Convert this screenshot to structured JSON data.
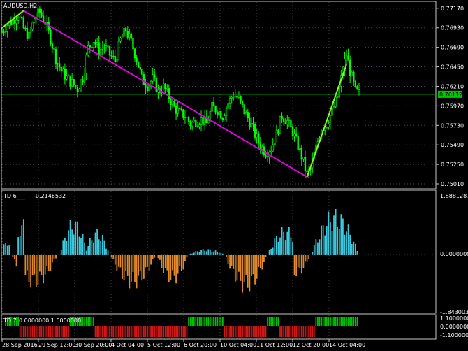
{
  "symbol_label": "AUDUSD,H2",
  "colors": {
    "background": "#000000",
    "frame": "#c8c8c8",
    "grid": "#3c4650",
    "candle": "#00ff00",
    "trend_line": "#e000e0",
    "cyan": "#3cc8dc",
    "orange": "#e08a2c",
    "bull_bar": "#00c000",
    "bear_bar": "#d01818",
    "current_price_bg": "#00c800"
  },
  "price_axis": {
    "labels": [
      "0.77170",
      "0.76930",
      "0.76690",
      "0.76450",
      "0.76210",
      "0.75970",
      "0.75730",
      "0.75490",
      "0.75250",
      "0.75010"
    ],
    "current_price": "0.76112"
  },
  "time_axis": {
    "labels": [
      "28 Sep 2016",
      "29 Sep 12:00",
      "30 Sep 20:00",
      "4 Oct 04:00",
      "5 Oct 12:00",
      "6 Oct 20:00",
      "10 Oct 04:00",
      "11 Oct 12:00",
      "12 Oct 20:00",
      "14 Oct 04:00"
    ]
  },
  "indicator1": {
    "title": "TD 6___",
    "value": "-0.2146532",
    "axis_labels": [
      "1.8881287",
      "0.0000000",
      "-1.8430038"
    ]
  },
  "indicator2": {
    "title": "TD 7",
    "values": "0.0000000 1.0000000",
    "axis_labels": [
      "1.1000000",
      "0.0000000",
      "-1.1000000"
    ]
  },
  "chart_data": {
    "type": "candlestick",
    "symbol": "AUDUSD",
    "timeframe": "H2",
    "ylim": [
      0.7495,
      0.7722
    ],
    "current_price": 0.76112,
    "close_path": [
      [
        0,
        0.7688
      ],
      [
        3,
        0.7697
      ],
      [
        6,
        0.7702
      ],
      [
        9,
        0.771
      ],
      [
        12,
        0.7692
      ],
      [
        15,
        0.7682
      ],
      [
        18,
        0.7705
      ],
      [
        21,
        0.7712
      ],
      [
        24,
        0.77
      ],
      [
        27,
        0.768
      ],
      [
        30,
        0.7655
      ],
      [
        33,
        0.764
      ],
      [
        36,
        0.7632
      ],
      [
        39,
        0.7625
      ],
      [
        42,
        0.7618
      ],
      [
        45,
        0.7632
      ],
      [
        48,
        0.7668
      ],
      [
        51,
        0.7678
      ],
      [
        54,
        0.7665
      ],
      [
        57,
        0.767
      ],
      [
        60,
        0.766
      ],
      [
        63,
        0.7652
      ],
      [
        66,
        0.7678
      ],
      [
        69,
        0.769
      ],
      [
        72,
        0.7675
      ],
      [
        75,
        0.7655
      ],
      [
        78,
        0.763
      ],
      [
        81,
        0.7622
      ],
      [
        84,
        0.763
      ],
      [
        87,
        0.7615
      ],
      [
        90,
        0.762
      ],
      [
        93,
        0.7608
      ],
      [
        96,
        0.7595
      ],
      [
        99,
        0.7588
      ],
      [
        102,
        0.7585
      ],
      [
        105,
        0.7575
      ],
      [
        108,
        0.7578
      ],
      [
        111,
        0.758
      ],
      [
        114,
        0.7575
      ],
      [
        117,
        0.7595
      ],
      [
        120,
        0.7592
      ],
      [
        123,
        0.7585
      ],
      [
        126,
        0.76
      ],
      [
        129,
        0.7612
      ],
      [
        132,
        0.7605
      ],
      [
        135,
        0.759
      ],
      [
        138,
        0.7578
      ],
      [
        141,
        0.7562
      ],
      [
        144,
        0.7548
      ],
      [
        147,
        0.754
      ],
      [
        150,
        0.7545
      ],
      [
        153,
        0.7562
      ],
      [
        156,
        0.7585
      ],
      [
        159,
        0.7578
      ],
      [
        162,
        0.7565
      ],
      [
        165,
        0.7548
      ],
      [
        168,
        0.7528
      ],
      [
        170,
        0.7512
      ],
      [
        172,
        0.752
      ],
      [
        175,
        0.7545
      ],
      [
        178,
        0.757
      ],
      [
        181,
        0.7575
      ],
      [
        184,
        0.759
      ],
      [
        187,
        0.7608
      ],
      [
        190,
        0.7642
      ],
      [
        192,
        0.766
      ],
      [
        194,
        0.764
      ],
      [
        197,
        0.7615
      ],
      [
        199,
        0.7612
      ]
    ],
    "trend_lines": [
      {
        "color": "magenta",
        "points": [
          [
            12,
            0.7714
          ],
          [
            170,
            0.75095
          ]
        ]
      },
      {
        "color": "green",
        "points": [
          [
            0,
            0.7693
          ],
          [
            12,
            0.7714
          ]
        ]
      },
      {
        "color": "green",
        "points": [
          [
            170,
            0.75095
          ],
          [
            192,
            0.7648
          ]
        ]
      }
    ],
    "indicators": [
      {
        "name": "TD 6___",
        "value": -0.2146532,
        "ylim": [
          -1.8430038,
          1.8881287
        ],
        "type": "histogram",
        "segments": [
          {
            "from": 0,
            "to": 5,
            "sign": 1,
            "peak": 0.6
          },
          {
            "from": 5,
            "to": 31,
            "sign": -1,
            "peak": 1.2
          },
          {
            "from": 8,
            "to": 14,
            "sign": 1,
            "peak": 1.4
          },
          {
            "from": 32,
            "to": 48,
            "sign": 1,
            "peak": 1.3
          },
          {
            "from": 46,
            "to": 60,
            "sign": 1,
            "peak": 0.9
          },
          {
            "from": 60,
            "to": 86,
            "sign": -1,
            "peak": 1.2
          },
          {
            "from": 86,
            "to": 104,
            "sign": -1,
            "peak": 1.05
          },
          {
            "from": 104,
            "to": 124,
            "sign": 1,
            "peak": 0.2
          },
          {
            "from": 124,
            "to": 148,
            "sign": -1,
            "peak": 1.35
          },
          {
            "from": 148,
            "to": 168,
            "sign": 1,
            "peak": 1.0
          },
          {
            "from": 156,
            "to": 172,
            "sign": -1,
            "peak": 0.8
          },
          {
            "from": 172,
            "to": 199,
            "sign": 1,
            "peak": 1.6
          }
        ]
      },
      {
        "name": "TD 7",
        "values": [
          0.0,
          1.0
        ],
        "ylim": [
          -1.1,
          1.1
        ],
        "type": "histogram",
        "segments": [
          {
            "from": 2,
            "to": 10,
            "sign": 1
          },
          {
            "from": 10,
            "to": 38,
            "sign": -1
          },
          {
            "from": 38,
            "to": 52,
            "sign": 1
          },
          {
            "from": 52,
            "to": 104,
            "sign": -1
          },
          {
            "from": 104,
            "to": 124,
            "sign": 1
          },
          {
            "from": 124,
            "to": 148,
            "sign": -1
          },
          {
            "from": 148,
            "to": 155,
            "sign": 1
          },
          {
            "from": 155,
            "to": 165,
            "sign": -1
          },
          {
            "from": 165,
            "to": 175,
            "sign": -1
          },
          {
            "from": 175,
            "to": 199,
            "sign": 1
          }
        ]
      }
    ]
  }
}
